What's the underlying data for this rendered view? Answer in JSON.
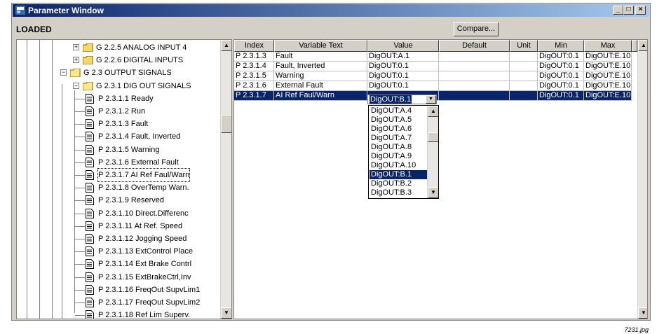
{
  "window": {
    "title": "Parameter Window",
    "minimize": "_",
    "maximize": "□",
    "close": "×"
  },
  "toolbar": {
    "status": "LOADED",
    "compare_label": "Compare..."
  },
  "tree": {
    "groups": [
      {
        "label": "G 2.2.5 ANALOG INPUT 4",
        "expander": "+"
      },
      {
        "label": "G 2.2.6 DIGITAL INPUTS",
        "expander": "+"
      },
      {
        "label": "G 2.3 OUTPUT SIGNALS",
        "expander": "−"
      },
      {
        "label": "G 2.3.1 DIG OUT SIGNALS",
        "expander": "−"
      }
    ],
    "items": [
      "P 2.3.1.1 Ready",
      "P 2.3.1.2 Run",
      "P 2.3.1.3 Fault",
      "P 2.3.1.4 Fault, Inverted",
      "P 2.3.1.5 Warning",
      "P 2.3.1.6 External Fault",
      "P 2.3.1.7 AI Ref Faul/Warn",
      "P 2.3.1.8 OverTemp Warn.",
      "P 2.3.1.9 Reserved",
      "P 2.3.1.10 Direct.Differenc",
      "P 2.3.1.11 At Ref. Speed",
      "P 2.3.1.12 Jogging Speed",
      "P 2.3.1.13 ExtControl Place",
      "P 2.3.1.14 Ext Brake Contrl",
      "P 2.3.1.15 ExtBrakeCtrl,Inv",
      "P 2.3.1.16 FreqOut SupvLim1",
      "P 2.3.1.17 FreqOut SupvLim2",
      "P 2.3.1.18 Ref Lim Superv."
    ],
    "selected_index": 6
  },
  "grid": {
    "columns": [
      "Index",
      "Variable Text",
      "Value",
      "Default",
      "Unit",
      "Min",
      "Max"
    ],
    "rows": [
      {
        "index": "P 2.3.1.3",
        "text": "Fault",
        "value": "DigOUT:A.1",
        "default": "",
        "unit": "",
        "min": "DigOUT:0.1",
        "max": "DigOUT:E.10"
      },
      {
        "index": "P 2.3.1.4",
        "text": "Fault, Inverted",
        "value": "DigOUT:0.1",
        "default": "",
        "unit": "",
        "min": "DigOUT:0.1",
        "max": "DigOUT:E.10"
      },
      {
        "index": "P 2.3.1.5",
        "text": "Warning",
        "value": "DigOUT:0.1",
        "default": "",
        "unit": "",
        "min": "DigOUT:0.1",
        "max": "DigOUT:E.10"
      },
      {
        "index": "P 2.3.1.6",
        "text": "External Fault",
        "value": "DigOUT:0.1",
        "default": "",
        "unit": "",
        "min": "DigOUT:0.1",
        "max": "DigOUT:E.10"
      },
      {
        "index": "P 2.3.1.7",
        "text": "AI Ref Faul/Warn",
        "value": "DigOUT:B.1",
        "default": "",
        "unit": "",
        "min": "DigOUT:0.1",
        "max": "DigOUT:E.10"
      }
    ],
    "selected_row": 4
  },
  "dropdown": {
    "options": [
      "DigOUT:A.4",
      "DigOUT:A.5",
      "DigOUT:A.6",
      "DigOUT:A.7",
      "DigOUT:A.8",
      "DigOUT:A.9",
      "DigOUT:A.10",
      "DigOUT:B.1",
      "DigOUT:B.2",
      "DigOUT:B.3"
    ],
    "selected_index": 7
  },
  "caption": "7231.jpg",
  "colors": {
    "titlebar": "#0a246a",
    "selection": "#0a246a",
    "face": "#d4d0c8"
  }
}
